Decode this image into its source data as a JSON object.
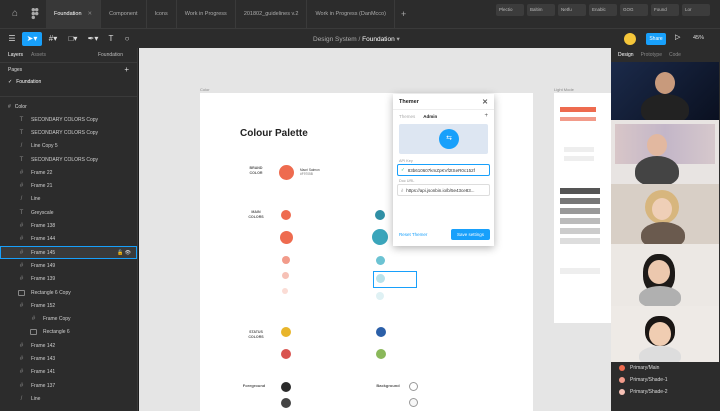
{
  "tabs": [
    {
      "label": "Foundation",
      "active": true
    },
    {
      "label": "Component",
      "active": false
    },
    {
      "label": "Icons",
      "active": false
    },
    {
      "label": "Work in Progress",
      "active": false
    },
    {
      "label": "201802_guidelines v.2",
      "active": false
    },
    {
      "label": "Work in Progress (DanMcco)",
      "active": false
    }
  ],
  "browser_tabs": [
    "Plectio",
    "Baltim",
    "Netfu",
    "Enablc",
    "GOG",
    "Found",
    "Lor"
  ],
  "toolbar": {
    "breadcrumb_project": "Design System",
    "breadcrumb_sep": "/",
    "breadcrumb_page": "Foundation",
    "share": "Share",
    "zoom": "45%"
  },
  "left_panel": {
    "tab_layers": "Layers",
    "tab_assets": "Assets",
    "page_label": "Foundation",
    "pages_title": "Pages",
    "current_page": "Foundation",
    "section": "Color",
    "layers": [
      {
        "label": "SECONDARY COLORS Copy",
        "icon": "text",
        "indent": 1
      },
      {
        "label": "SECONDARY COLORS Copy",
        "icon": "text",
        "indent": 1
      },
      {
        "label": "Line Copy 5",
        "icon": "line",
        "indent": 1
      },
      {
        "label": "SECONDARY COLORS Copy",
        "icon": "text",
        "indent": 1
      },
      {
        "label": "Frame 22",
        "icon": "frame",
        "indent": 1
      },
      {
        "label": "Frame 21",
        "icon": "frame",
        "indent": 1
      },
      {
        "label": "Line",
        "icon": "line",
        "indent": 1
      },
      {
        "label": "Greyscale",
        "icon": "text",
        "indent": 1
      },
      {
        "label": "Frame 138",
        "icon": "frame",
        "indent": 1
      },
      {
        "label": "Frame 144",
        "icon": "frame",
        "indent": 1
      },
      {
        "label": "Frame 145",
        "icon": "frame",
        "indent": 1,
        "highlight": true
      },
      {
        "label": "Frame 149",
        "icon": "frame",
        "indent": 1
      },
      {
        "label": "Frame 139",
        "icon": "frame",
        "indent": 1
      },
      {
        "label": "Rectangle 6 Copy",
        "icon": "rect",
        "indent": 1
      },
      {
        "label": "Frame 152",
        "icon": "frame",
        "indent": 1
      },
      {
        "label": "Frame Copy",
        "icon": "frame",
        "indent": 2
      },
      {
        "label": "Rectangle 6",
        "icon": "rect",
        "indent": 2
      },
      {
        "label": "Frame 142",
        "icon": "frame",
        "indent": 1
      },
      {
        "label": "Frame 143",
        "icon": "frame",
        "indent": 1
      },
      {
        "label": "Frame 141",
        "icon": "frame",
        "indent": 1
      },
      {
        "label": "Frame 137",
        "icon": "frame",
        "indent": 1
      },
      {
        "label": "Line",
        "icon": "line",
        "indent": 1
      }
    ]
  },
  "canvas": {
    "frame_label_left": "Color",
    "frame_label_right": "Light Mode",
    "title": "Colour Palette",
    "sections": {
      "brand": "BRAND\nCOLOR",
      "main": "MAIN\nCOLORS",
      "status": "STATUS\nCOLORS",
      "foreground": "Foreground",
      "background": "Background"
    },
    "brand_swatch": {
      "name": "Maori Salmon",
      "hex": "#F9705B",
      "color": "#ee6b4f"
    },
    "colors": {
      "salmon": "#ee6b4f",
      "salmon_light": "#f29b8a",
      "teal": "#2f8fa5",
      "teal_light": "#6cc3d3",
      "yellow": "#e8b52b",
      "green": "#8ab85a",
      "blue": "#2b5fa8",
      "red": "#d9534f",
      "dark": "#2b2b2b"
    }
  },
  "themer": {
    "title": "Themer",
    "tab_themes": "Themes",
    "tab_admin": "Admin",
    "api_key_label": "API Key",
    "api_key_value": "83b610607kmZpKVf2tSeR0c152f",
    "doc_url_label": "Doc URL",
    "doc_url_value": "https://api.jsonbin.io/b/5e43ce83...",
    "reset": "Reset Themer",
    "save": "Save settings"
  },
  "right_panel": {
    "tab_design": "Design",
    "tab_prototype": "Prototype",
    "tab_code": "Code"
  },
  "primary_list": [
    {
      "label": "Primary/Main",
      "color": "#ee6b4f"
    },
    {
      "label": "Primary/Shade-1",
      "color": "#f29b8a"
    },
    {
      "label": "Primary/Shade-2",
      "color": "#f6c1b6"
    }
  ]
}
